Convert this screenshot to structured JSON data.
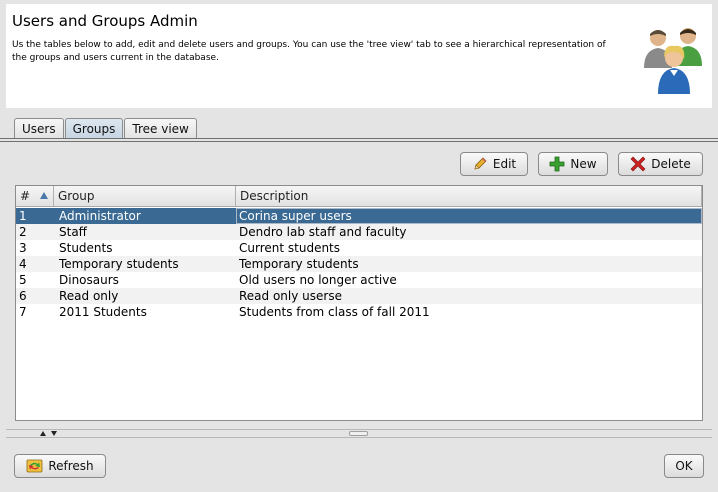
{
  "header": {
    "title": "Users and Groups Admin",
    "description": "Us the tables below to add, edit and delete users and groups.  You can use the 'tree view' tab to see a hierarchical representation of the groups and users current in the database.",
    "icon": "users-group-icon"
  },
  "tabs": [
    {
      "label": "Users",
      "active": false
    },
    {
      "label": "Groups",
      "active": true
    },
    {
      "label": "Tree view",
      "active": false
    }
  ],
  "toolbar": {
    "edit_label": "Edit",
    "new_label": "New",
    "delete_label": "Delete"
  },
  "table": {
    "columns": [
      "#",
      "Group",
      "Description"
    ],
    "sort_column": "#",
    "sort_direction": "ascending",
    "selected_row": 1,
    "rows": [
      {
        "num": "1",
        "group": "Administrator",
        "description": "Corina super users"
      },
      {
        "num": "2",
        "group": "Staff",
        "description": "Dendro lab staff and faculty"
      },
      {
        "num": "3",
        "group": "Students",
        "description": "Current students"
      },
      {
        "num": "4",
        "group": "Temporary students",
        "description": "Temporary students"
      },
      {
        "num": "5",
        "group": "Dinosaurs",
        "description": "Old users no longer active"
      },
      {
        "num": "6",
        "group": "Read only",
        "description": "Read only userse"
      },
      {
        "num": "7",
        "group": "2011 Students",
        "description": "Students from class of fall 2011"
      }
    ]
  },
  "footer": {
    "refresh_label": "Refresh",
    "ok_label": "OK"
  },
  "colors": {
    "selection": "#3a6a93",
    "active_tab": "#c6d4e2",
    "delete_icon": "#cc2222",
    "new_icon": "#3aa030"
  }
}
